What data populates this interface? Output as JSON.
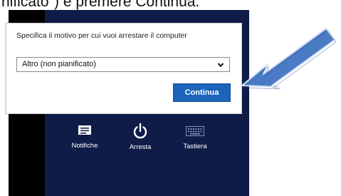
{
  "top_text": "nificato\") e premere Continua.",
  "dialog": {
    "prompt": "Specifica il motivo per cui vuoi arrestare il computer",
    "select_value": "Altro (non pianificato)",
    "continue_label": "Continua"
  },
  "charms": [
    {
      "label": "Notifiche",
      "icon": "notifications-icon"
    },
    {
      "label": "Arresta",
      "icon": "power-icon"
    },
    {
      "label": "Tastiera",
      "icon": "keyboard-icon"
    }
  ],
  "colors": {
    "panel": "#0f1c48",
    "button": "#1c64b8",
    "arrow": "#4a7bc4"
  }
}
